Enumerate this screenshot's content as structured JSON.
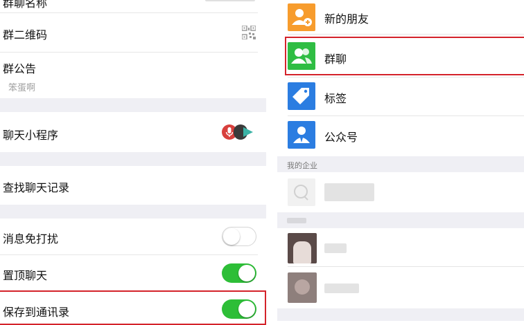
{
  "left": {
    "top_partial_label": "群聊名称",
    "qr_row": {
      "label": "群二维码"
    },
    "notice_row": {
      "label": "群公告",
      "content": "笨蛋啊"
    },
    "mini_program_row": {
      "label": "聊天小程序"
    },
    "search_history_row": {
      "label": "查找聊天记录"
    },
    "mute_row": {
      "label": "消息免打扰",
      "toggle_state": "off"
    },
    "pin_row": {
      "label": "置顶聊天",
      "toggle_state": "on"
    },
    "save_contacts_row": {
      "label": "保存到通讯录",
      "toggle_state": "on"
    }
  },
  "right": {
    "items": [
      {
        "label": "新的朋友",
        "icon": "add-friend-icon",
        "color": "#f79c2d"
      },
      {
        "label": "群聊",
        "icon": "group-chat-icon",
        "color": "#2fbd43"
      },
      {
        "label": "标签",
        "icon": "tag-icon",
        "color": "#2b7de1"
      },
      {
        "label": "公众号",
        "icon": "official-account-icon",
        "color": "#2b7de1"
      }
    ],
    "enterprise_header": "我的企业"
  },
  "colors": {
    "toggle_on": "#2dbe37",
    "highlight_box": "#d4222a",
    "section_background": "#efeff4"
  }
}
